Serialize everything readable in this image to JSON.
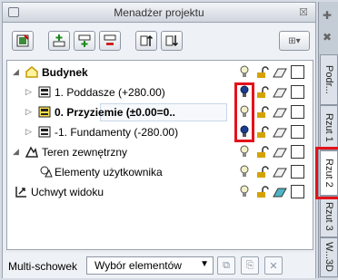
{
  "window": {
    "title": "Menadżer projektu",
    "close_glyph": "☒"
  },
  "toolbar": {
    "buttons": [
      {
        "name": "properties-button",
        "icon": "properties-icon",
        "glyph": "☑"
      },
      {
        "name": "add-story-above-button",
        "icon": "add-story-above-icon",
        "glyph": "⊞"
      },
      {
        "name": "add-story-below-button",
        "icon": "add-story-below-icon",
        "glyph": "⊞"
      },
      {
        "name": "delete-story-button",
        "icon": "delete-story-icon",
        "glyph": "⊟"
      },
      {
        "name": "move-up-button",
        "icon": "move-up-icon",
        "glyph": "⇅"
      },
      {
        "name": "move-down-button",
        "icon": "move-down-icon",
        "glyph": "⇅"
      }
    ],
    "filter_dropdown": {
      "icon": "filter-icon",
      "glyph": "⊞▾"
    }
  },
  "tree": {
    "rows": [
      {
        "label": "Budynek",
        "bold": true,
        "level": 1,
        "expander": "◢",
        "icon": "building-icon",
        "bulb": "off",
        "check": false
      },
      {
        "label": "1. Poddasze (+280.00)",
        "bold": false,
        "level": 2,
        "expander": "▷",
        "icon": "story-icon",
        "bulb": "on",
        "check": false
      },
      {
        "label": "0. Przyziemie (±0.00=0..",
        "bold": true,
        "level": 2,
        "expander": "▷",
        "icon": "story-active-icon",
        "bulb": "off",
        "check": false,
        "selected": true
      },
      {
        "label": "-1. Fundamenty (-280.00)",
        "bold": false,
        "level": 2,
        "expander": "▷",
        "icon": "story-icon",
        "bulb": "on",
        "check": false
      },
      {
        "label": "Teren zewnętrzny",
        "bold": false,
        "level": 1,
        "expander": "◢",
        "icon": "terrain-icon",
        "bulb": "off",
        "check": false
      },
      {
        "label": "Elementy użytkownika",
        "bold": false,
        "level": 2,
        "expander": "",
        "icon": "user-elements-icon",
        "bulb": "off",
        "check": false
      },
      {
        "label": "Uchwyt widoku",
        "bold": false,
        "level": 1,
        "expander": "",
        "icon": "view-handle-icon",
        "bulb": "off",
        "check": false
      }
    ]
  },
  "bottom": {
    "label": "Multi-schowek",
    "combo_value": "Wybór elementów",
    "combo_arrow": "▼",
    "copy_glyph": "⧉",
    "paste_glyph": "⎘",
    "delete_glyph": "✕"
  },
  "side_tabs": [
    {
      "label": "Podr..."
    },
    {
      "label": "Rzut 1"
    },
    {
      "label": "Rzut 2",
      "active": true
    },
    {
      "label": "Rzut 3"
    },
    {
      "label": "W...3D"
    }
  ],
  "side_icons": {
    "pin_glyph": "✚",
    "close_glyph": "✖"
  },
  "colors": {
    "highlight": "#e3121b",
    "bulb_on": "#1a3d8f",
    "bulb_off": "#f3f0c8"
  }
}
